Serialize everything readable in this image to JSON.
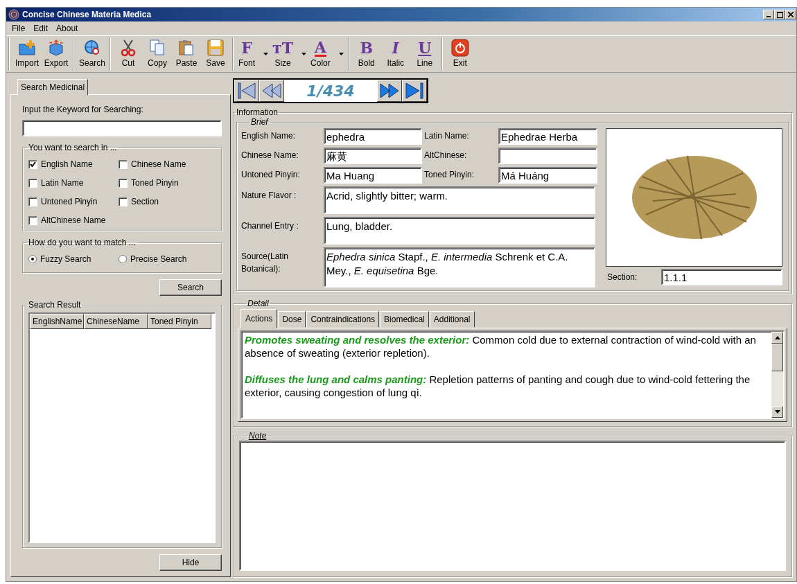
{
  "window": {
    "title": "Concise Chinese Materia Medica"
  },
  "menu": [
    {
      "label": "File"
    },
    {
      "label": "Edit"
    },
    {
      "label": "About"
    }
  ],
  "toolbar": [
    [
      {
        "kind": "import",
        "label": "Import",
        "dropdown": false
      },
      {
        "kind": "export",
        "label": "Export",
        "dropdown": false
      }
    ],
    [
      {
        "kind": "search",
        "label": "Search",
        "dropdown": false
      }
    ],
    [
      {
        "kind": "cut",
        "label": "Cut",
        "dropdown": false
      },
      {
        "kind": "copy",
        "label": "Copy",
        "dropdown": false
      },
      {
        "kind": "paste",
        "label": "Paste",
        "dropdown": false
      },
      {
        "kind": "save",
        "label": "Save",
        "dropdown": false
      }
    ],
    [
      {
        "kind": "font",
        "label": "Font",
        "glyph": "F",
        "dropdown": true
      },
      {
        "kind": "size",
        "label": "Size",
        "glyph": "ᴛT",
        "dropdown": true
      },
      {
        "kind": "color",
        "label": "Color",
        "glyph": "A",
        "dropdown": true
      }
    ],
    [
      {
        "kind": "bold",
        "label": "Bold",
        "glyph": "B",
        "dropdown": false
      },
      {
        "kind": "italic",
        "label": "Italic",
        "glyph": "I",
        "dropdown": false
      },
      {
        "kind": "underline",
        "label": "Line",
        "glyph": "U",
        "dropdown": false
      }
    ],
    [
      {
        "kind": "exit",
        "label": "Exit",
        "dropdown": false
      }
    ]
  ],
  "search_panel": {
    "tab": {
      "label": "Search Medicinal",
      "selected": true
    },
    "keyword_label": "Input the Keyword for Searching:",
    "search_in": {
      "title": "You want to search in ...",
      "options": [
        {
          "label": "English Name",
          "checked": true
        },
        {
          "label": "Chinese Name",
          "checked": false
        },
        {
          "label": "Latin Name",
          "checked": false
        },
        {
          "label": "Toned Pinyin",
          "checked": false
        },
        {
          "label": "Untoned Pinyin",
          "checked": false
        },
        {
          "label": "Section",
          "checked": false
        },
        {
          "label": "AltChinese Name",
          "checked": false
        }
      ]
    },
    "match": {
      "title": "How do you want to match ...",
      "options": [
        {
          "label": "Fuzzy Search",
          "selected": true
        },
        {
          "label": "Precise Search",
          "selected": false
        }
      ]
    },
    "search_button": "Search",
    "results": {
      "title": "Search Result",
      "columns": [
        "EnglishName",
        "ChineseName",
        "Toned Pinyin"
      ]
    },
    "hide_button": "Hide"
  },
  "navigator": {
    "page": "1/434"
  },
  "information": {
    "title": "Information",
    "brief": {
      "title": "Brief",
      "fields": [
        {
          "label": "English Name:",
          "value": "ephedra"
        },
        {
          "label": "Latin Name:",
          "value": "Ephedrae Herba"
        },
        {
          "label": "Chinese Name:",
          "value": "麻黄"
        },
        {
          "label": "AltChinese:"
        },
        {
          "label": "Untoned Pinyin:",
          "value": "Ma Huang"
        },
        {
          "label": "Toned Pinyin:",
          "value": "Má Huáng"
        }
      ],
      "long_fields": [
        {
          "label": "Nature Flavor :",
          "value": "Acrid, slightly bitter; warm."
        },
        {
          "label": "Channel Entry :",
          "value": "Lung, bladder."
        },
        {
          "label": "Source(Latin Botanical):",
          "value": "*Ephedra sinica* Stapf., *E. intermedia* Schrenk et C.A. Mey., *E. equisetina* Bge."
        }
      ],
      "section": {
        "label": "Section:",
        "value": "1.1.1"
      }
    }
  },
  "detail": {
    "title": "Detail",
    "tabs": [
      {
        "label": "Actions",
        "selected": true
      },
      {
        "label": "Dose",
        "selected": false
      },
      {
        "label": "Contraindications",
        "selected": false
      },
      {
        "label": "Biomedical",
        "selected": false
      },
      {
        "label": "Additional",
        "selected": false
      }
    ],
    "paragraphs": [
      {
        "heading": "Promotes sweating and resolves the exterior:",
        "text": " Common cold due to external contraction of wind-cold with an absence of sweating (exterior repletion)."
      },
      {
        "heading": "Diffuses the lung and calms panting:",
        "text": " Repletion patterns of panting and cough due to wind-cold fettering the exterior, causing congestion of lung qì."
      }
    ]
  },
  "note": {
    "title": "Note"
  }
}
